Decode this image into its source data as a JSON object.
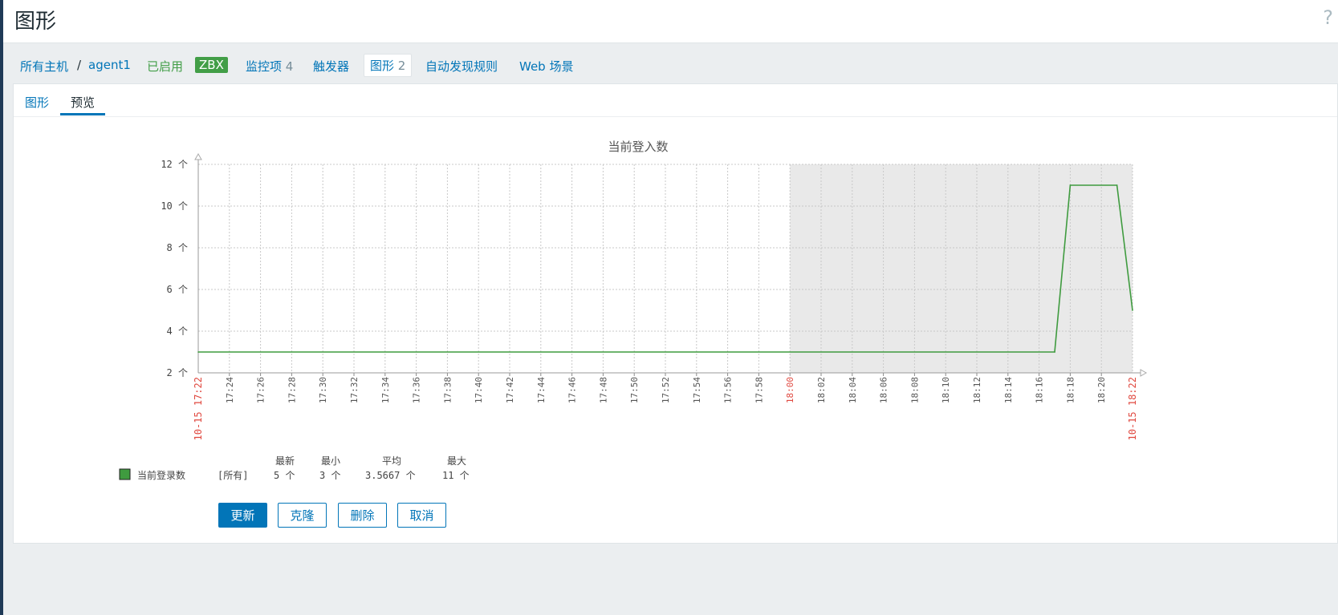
{
  "header": {
    "title": "图形",
    "help_icon": "?"
  },
  "nav": {
    "all_hosts": "所有主机",
    "separator": "/",
    "host": "agent1",
    "status": "已启用",
    "zbx": "ZBX",
    "items_label": "监控项",
    "items_count": "4",
    "triggers": "触发器",
    "graphs_label": "图形",
    "graphs_count": "2",
    "discovery": "自动发现规则",
    "web": "Web 场景"
  },
  "tabs": [
    "图形",
    "预览"
  ],
  "chart_data": {
    "type": "line",
    "title": "当前登入数",
    "unit": "个",
    "ylim": [
      2,
      12
    ],
    "y_ticks": [
      "12 个",
      "10 个",
      "8 个",
      "6 个",
      "4 个",
      "2 个"
    ],
    "x_start_label": "10-15 17:22",
    "x_end_label": "10-15 18:22",
    "x_ticks": [
      "17:24",
      "17:26",
      "17:28",
      "17:30",
      "17:32",
      "17:34",
      "17:36",
      "17:38",
      "17:40",
      "17:42",
      "17:44",
      "17:46",
      "17:48",
      "17:50",
      "17:52",
      "17:54",
      "17:56",
      "17:58",
      "18:00",
      "18:02",
      "18:04",
      "18:06",
      "18:08",
      "18:10",
      "18:12",
      "18:14",
      "18:16",
      "18:18",
      "18:20"
    ],
    "highlight_tick": "18:00",
    "shaded_region": [
      "18:00",
      "18:22"
    ],
    "grid": true,
    "series": [
      {
        "name": "当前登录数",
        "color": "#3f9b3f",
        "x": [
          "17:22",
          "18:17",
          "18:18",
          "18:21",
          "18:22"
        ],
        "x_minutes": [
          0,
          55,
          56,
          59,
          60
        ],
        "values": [
          3,
          3,
          11,
          11,
          5
        ]
      }
    ],
    "legend": {
      "headers": [
        "最新",
        "最小",
        "平均",
        "最大"
      ],
      "item_label": "当前登录数",
      "function": "[所有]",
      "last": "5 个",
      "min": "3 个",
      "avg": "3.5667 个",
      "max": "11 个"
    }
  },
  "buttons": {
    "update": "更新",
    "clone": "克隆",
    "delete": "删除",
    "cancel": "取消"
  }
}
